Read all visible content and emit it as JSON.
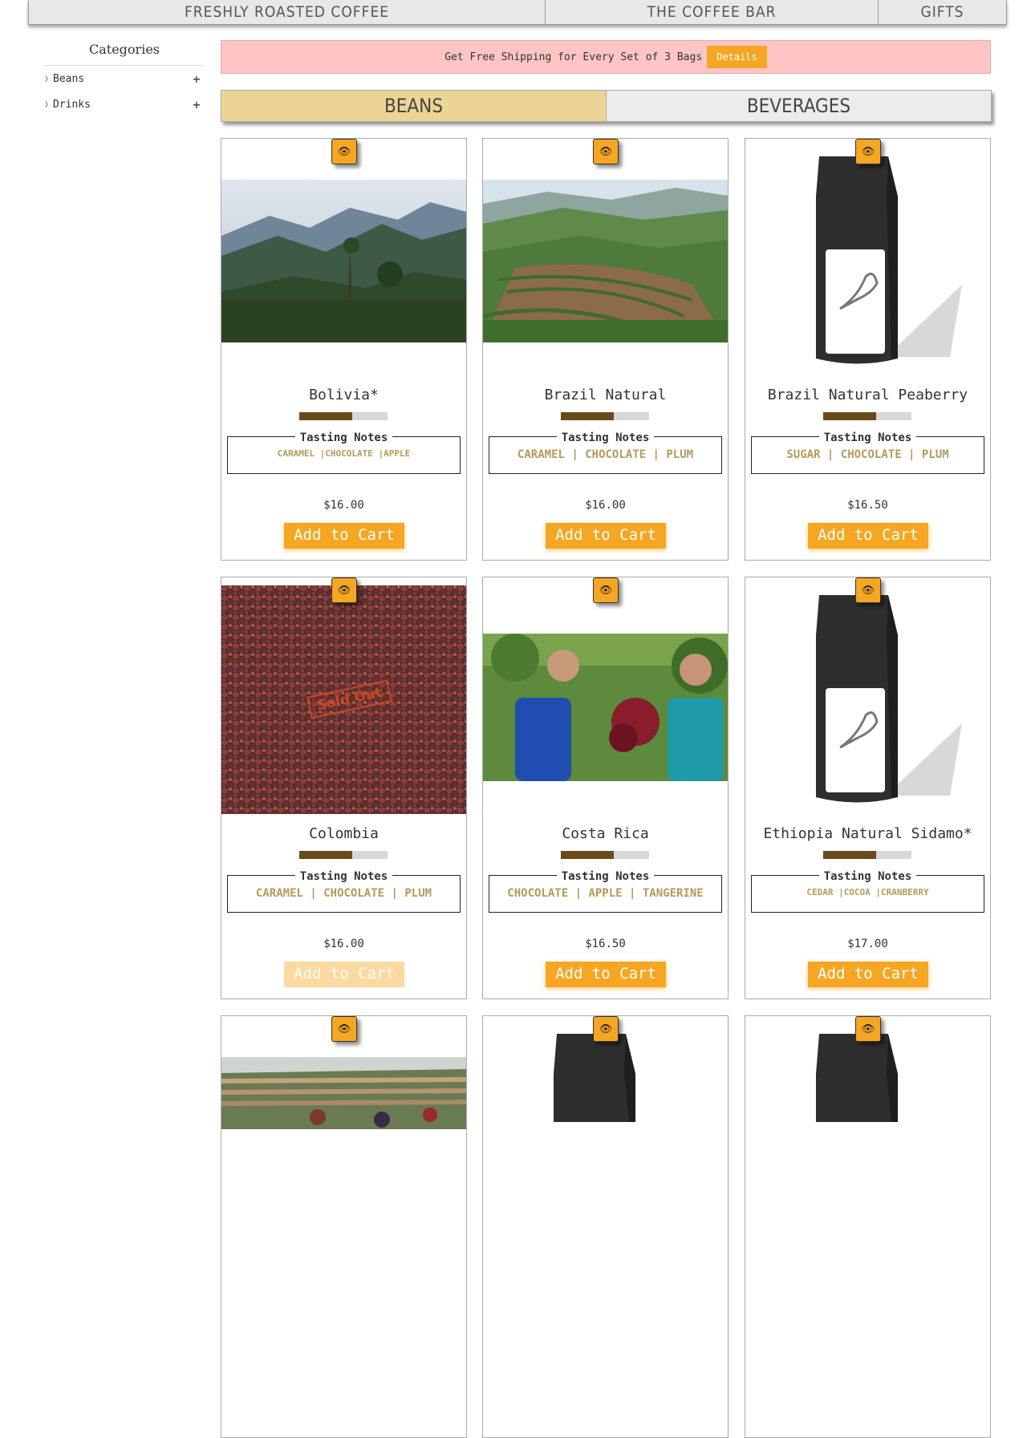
{
  "topnav": {
    "items": [
      "Freshly Roasted Coffee",
      "The Coffee Bar",
      "Gifts"
    ]
  },
  "sidebar": {
    "title": "Categories",
    "items": [
      {
        "label": "Beans",
        "toggle": "+"
      },
      {
        "label": "Drinks",
        "toggle": "+"
      }
    ]
  },
  "banner": {
    "text": "Get Free Shipping for Every Set of 3 Bags",
    "button": "Details"
  },
  "tabs": [
    {
      "label": "Beans",
      "active": true
    },
    {
      "label": "Beverages",
      "active": false
    }
  ],
  "colors": {
    "accent": "#f5a623",
    "banner_bg": "#ffc5c5",
    "active_tab": "#ecd594",
    "notes_text": "#b49a5b",
    "roast_fill": "#6b4a1a"
  },
  "icons": {
    "quick_view": "eye-icon",
    "category_expand": "plus-icon",
    "category_chevron": "chevron-right-icon"
  },
  "products": [
    {
      "name": "Bolivia*",
      "roast_level": 0.6,
      "tasting_label": "Tasting Notes",
      "notes": "CARAMEL |CHOCOLATE |APPLE",
      "price": "$16.00",
      "cart": "Add to Cart",
      "sold_out": false
    },
    {
      "name": "Brazil Natural",
      "roast_level": 0.6,
      "tasting_label": "Tasting Notes",
      "notes": "CARAMEL | CHOCOLATE | PLUM",
      "price": "$16.00",
      "cart": "Add to Cart",
      "sold_out": false
    },
    {
      "name": "Brazil Natural Peaberry",
      "roast_level": 0.6,
      "tasting_label": "Tasting Notes",
      "notes": "SUGAR | CHOCOLATE | PLUM",
      "price": "$16.50",
      "cart": "Add to Cart",
      "sold_out": false
    },
    {
      "name": "Colombia",
      "roast_level": 0.6,
      "tasting_label": "Tasting Notes",
      "notes": "CARAMEL | CHOCOLATE | PLUM",
      "price": "$16.00",
      "cart": "Add to Cart",
      "sold_out": true,
      "stamp": "Sold Out"
    },
    {
      "name": "Costa Rica",
      "roast_level": 0.6,
      "tasting_label": "Tasting Notes",
      "notes": "CHOCOLATE | APPLE | TANGERINE",
      "price": "$16.50",
      "cart": "Add to Cart",
      "sold_out": false
    },
    {
      "name": "Ethiopia Natural Sidamo*",
      "roast_level": 0.6,
      "tasting_label": "Tasting Notes",
      "notes": "CEDAR |COCOA |CRANBERRY",
      "price": "$17.00",
      "cart": "Add to Cart",
      "sold_out": false
    }
  ]
}
